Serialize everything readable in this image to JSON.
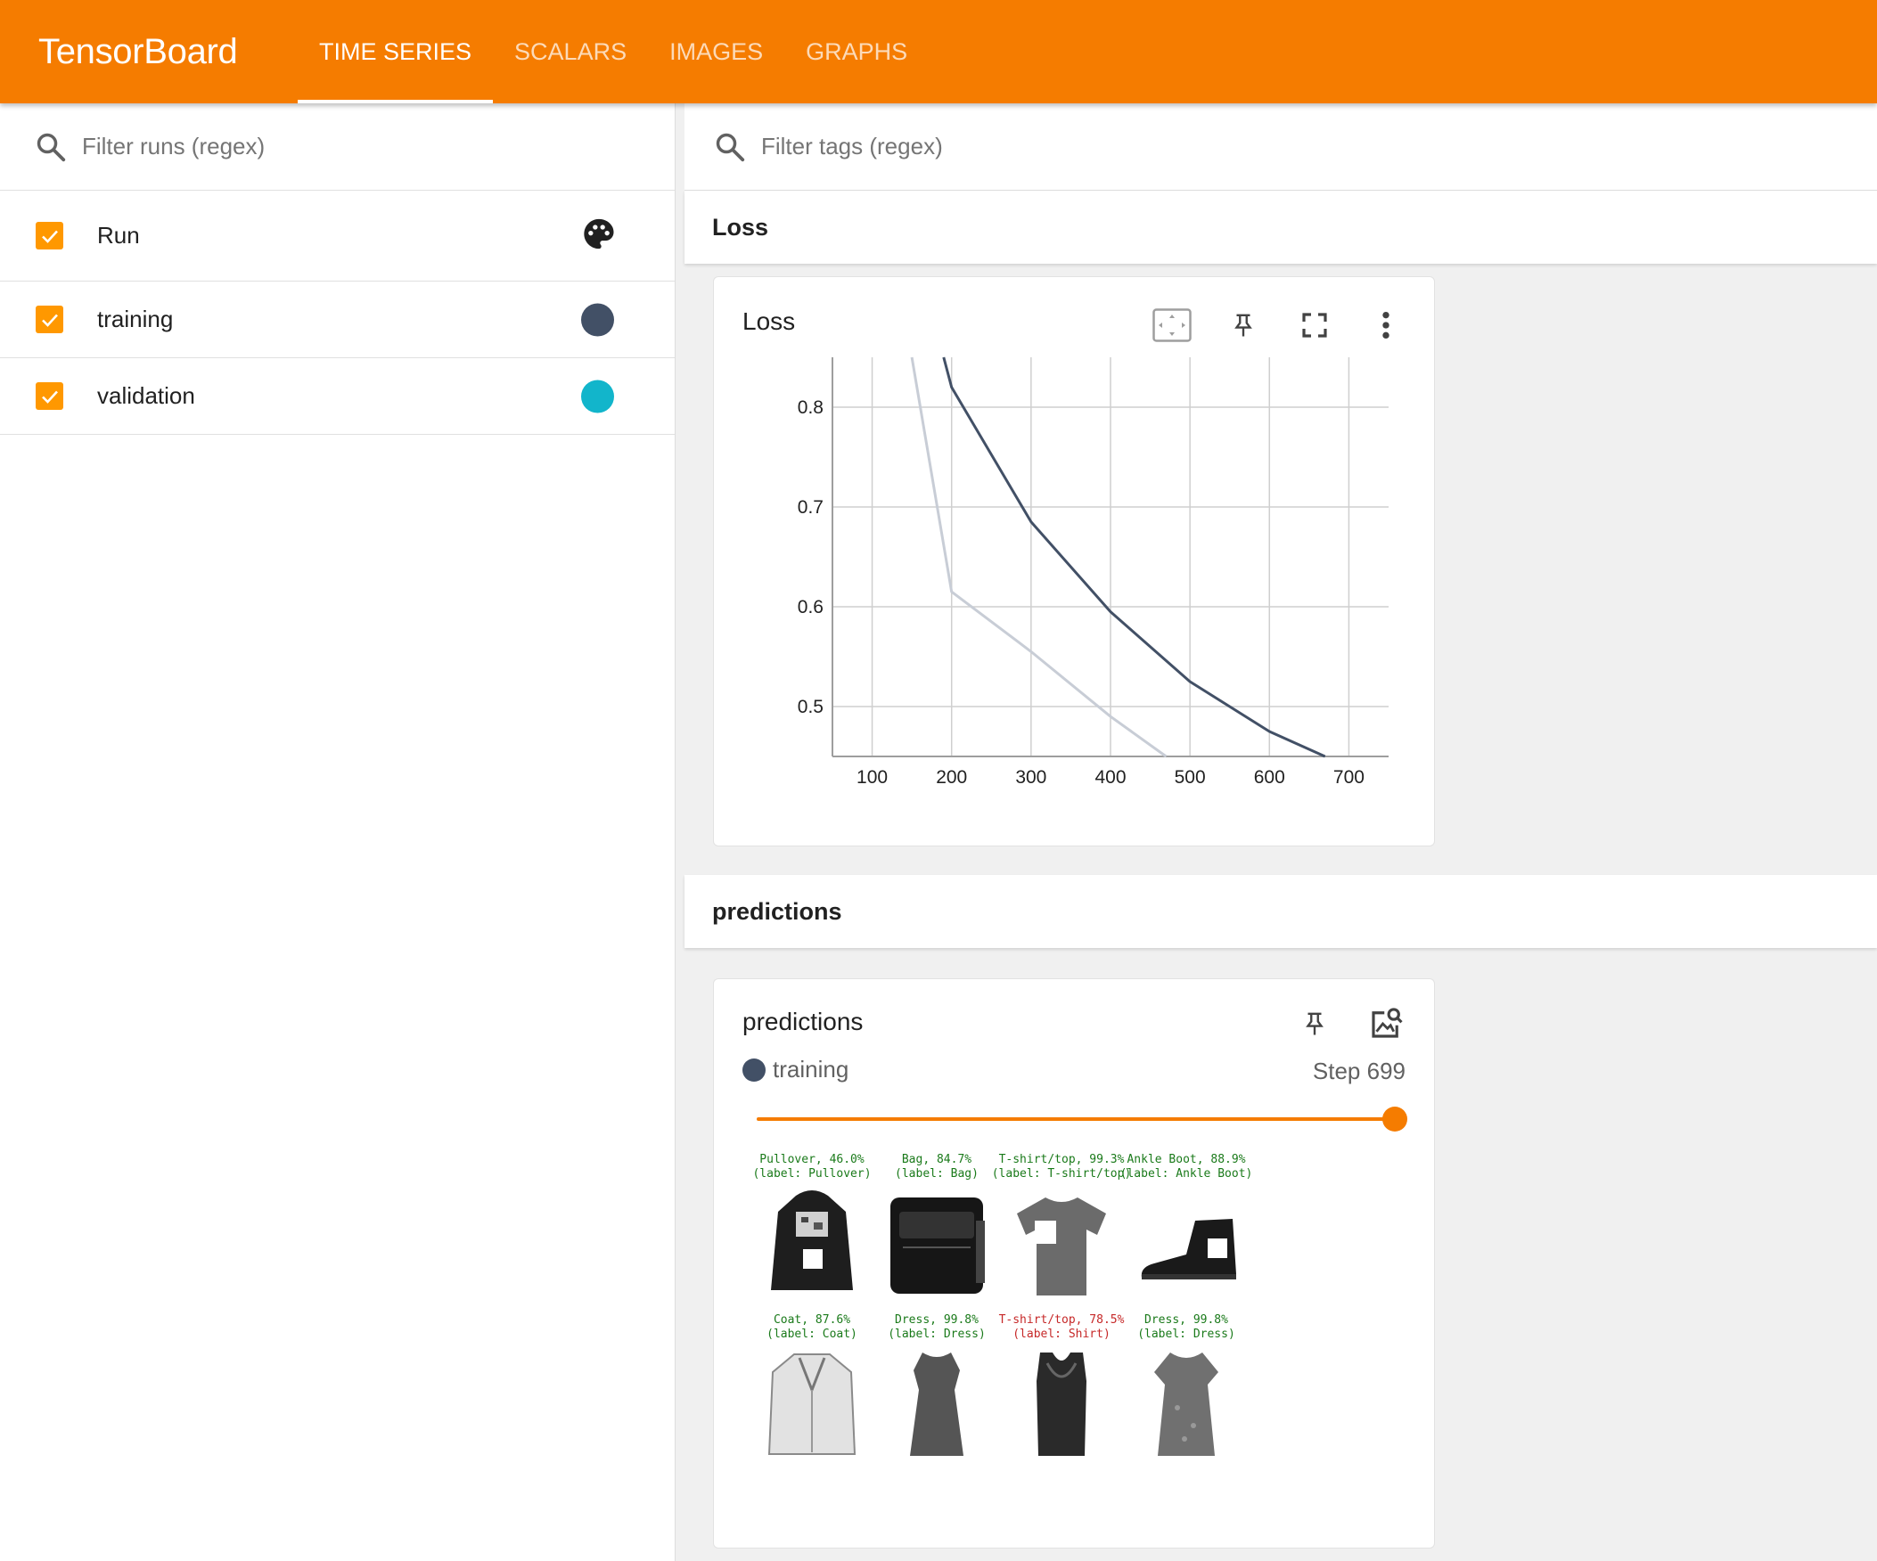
{
  "app": {
    "title": "TensorBoard"
  },
  "tabs": [
    {
      "label": "TIME SERIES",
      "active": true
    },
    {
      "label": "SCALARS",
      "active": false
    },
    {
      "label": "IMAGES",
      "active": false
    },
    {
      "label": "GRAPHS",
      "active": false
    }
  ],
  "sidebar": {
    "filter_placeholder": "Filter runs (regex)",
    "header_label": "Run",
    "runs": [
      {
        "label": "training",
        "color": "#425066"
      },
      {
        "label": "validation",
        "color": "#12b5cb"
      }
    ]
  },
  "main": {
    "tag_filter_placeholder": "Filter tags (regex)",
    "groups": [
      {
        "name": "Loss"
      },
      {
        "name": "predictions"
      }
    ]
  },
  "loss_card": {
    "title": "Loss",
    "chart_data": {
      "type": "line",
      "xlabel": "",
      "ylabel": "",
      "x_ticks": [
        100,
        200,
        300,
        400,
        500,
        600,
        700
      ],
      "y_ticks": [
        0.5,
        0.6,
        0.7,
        0.8
      ],
      "xlim": [
        50,
        750
      ],
      "ylim": [
        0.45,
        0.85
      ],
      "grid": true,
      "series": [
        {
          "color": "#c8cdd6",
          "x": [
            150,
            200,
            300,
            400,
            470
          ],
          "y": [
            0.85,
            0.615,
            0.555,
            0.49,
            0.45
          ]
        },
        {
          "color": "#425066",
          "x": [
            190,
            200,
            300,
            400,
            500,
            600,
            670
          ],
          "y": [
            0.85,
            0.82,
            0.685,
            0.595,
            0.525,
            0.475,
            0.45
          ]
        }
      ]
    }
  },
  "predictions_card": {
    "title": "predictions",
    "run_label": "training",
    "run_color": "#425066",
    "step_label": "Step 699",
    "slider_fraction": 1.0,
    "items": [
      {
        "caption1": "Pullover, 46.0%",
        "caption2": "(label: Pullover)",
        "correct": true,
        "kind": "hoodie"
      },
      {
        "caption1": "Bag, 84.7%",
        "caption2": "(label: Bag)",
        "correct": true,
        "kind": "bag"
      },
      {
        "caption1": "T-shirt/top, 99.3%",
        "caption2": "(label: T-shirt/top)",
        "correct": true,
        "kind": "tshirt"
      },
      {
        "caption1": "Ankle Boot, 88.9%",
        "caption2": "(label: Ankle Boot)",
        "correct": true,
        "kind": "boot"
      },
      {
        "caption1": "Coat, 87.6%",
        "caption2": "(label: Coat)",
        "correct": true,
        "kind": "coat"
      },
      {
        "caption1": "Dress, 99.8%",
        "caption2": "(label: Dress)",
        "correct": true,
        "kind": "dress"
      },
      {
        "caption1": "T-shirt/top, 78.5%",
        "caption2": "(label: Shirt)",
        "correct": false,
        "kind": "tank"
      },
      {
        "caption1": "Dress, 99.8%",
        "caption2": "(label: Dress)",
        "correct": true,
        "kind": "dress2"
      }
    ]
  }
}
